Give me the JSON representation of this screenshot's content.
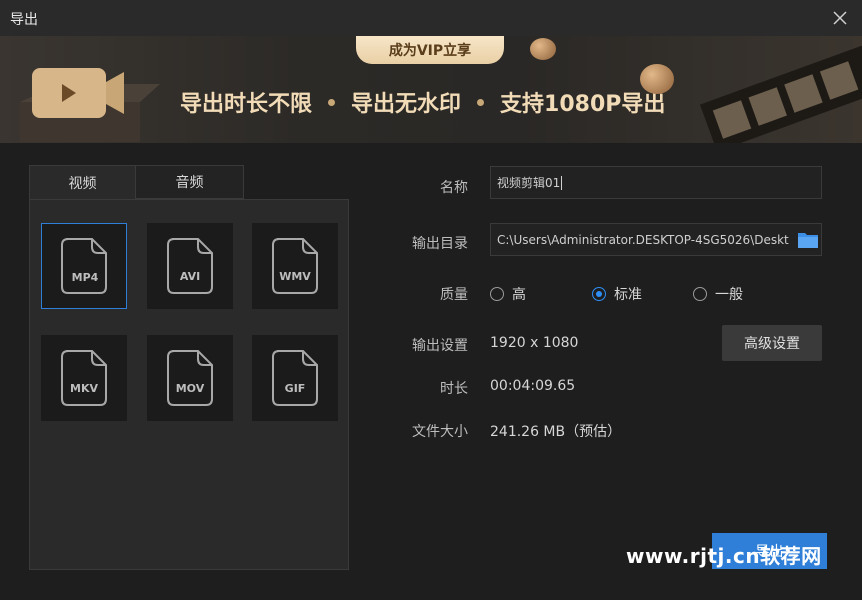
{
  "window": {
    "title": "导出"
  },
  "banner": {
    "vip_tab": "成为VIP立享",
    "features": [
      "导出时长不限",
      "导出无水印",
      "支持1080P导出"
    ]
  },
  "tabs": [
    {
      "label": "视频"
    },
    {
      "label": "音频"
    }
  ],
  "formats": [
    {
      "label": "MP4"
    },
    {
      "label": "AVI"
    },
    {
      "label": "WMV"
    },
    {
      "label": "MKV"
    },
    {
      "label": "MOV"
    },
    {
      "label": "GIF"
    }
  ],
  "form": {
    "name_label": "名称",
    "name_value": "视频剪辑01",
    "output_dir_label": "输出目录",
    "output_dir_value": "C:\\Users\\Administrator.DESKTOP-4SG5026\\Desktc",
    "quality_label": "质量",
    "quality_options": [
      "高",
      "标准",
      "一般"
    ],
    "quality_selected": "标准",
    "output_settings_label": "输出设置",
    "output_settings_value": "1920 x 1080",
    "advanced_button": "高级设置",
    "duration_label": "时长",
    "duration_value": "00:04:09.65",
    "filesize_label": "文件大小",
    "filesize_value": "241.26 MB（预估）"
  },
  "export_button": "导出",
  "watermark": "www.rjtj.cn软荐网",
  "colors": {
    "accent": "#2f7fd8",
    "background": "#1e1e1e",
    "banner_text": "#f2dcb8"
  }
}
